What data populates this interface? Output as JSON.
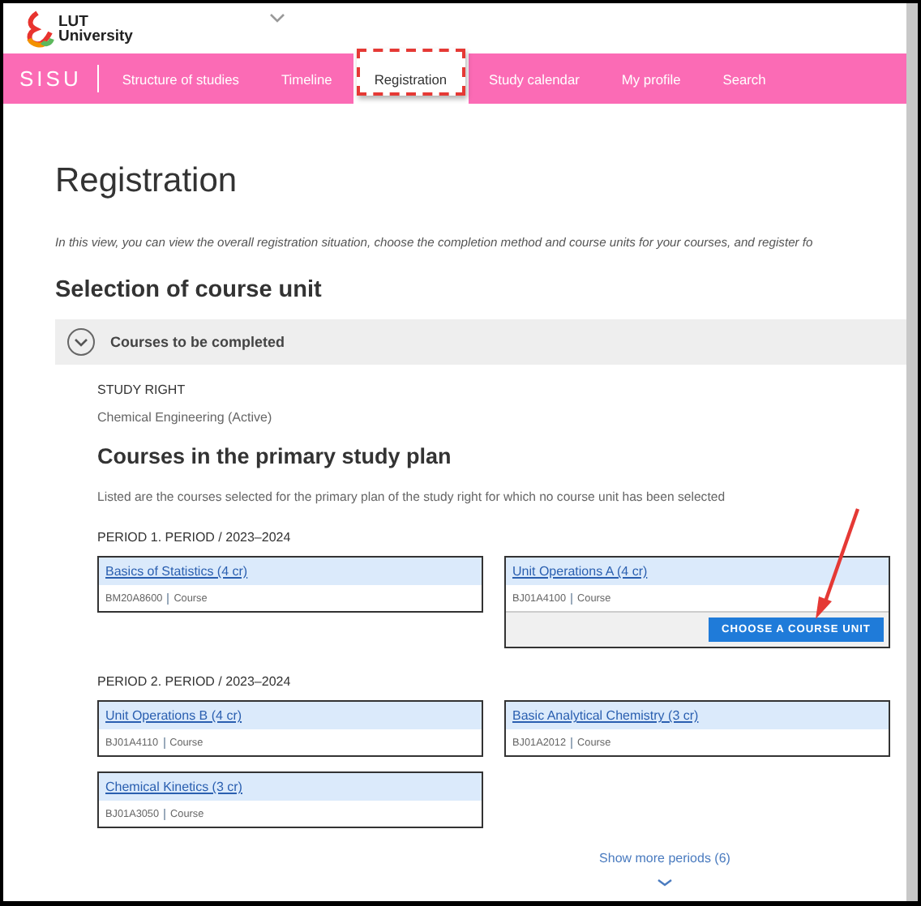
{
  "header": {
    "logo": "LUT\nUniversity"
  },
  "nav": {
    "brand": "SISU",
    "items": [
      {
        "label": "Structure of studies",
        "selected": false
      },
      {
        "label": "Timeline",
        "selected": false
      },
      {
        "label": "Registration",
        "selected": true
      },
      {
        "label": "Study calendar",
        "selected": false
      },
      {
        "label": "My profile",
        "selected": false
      },
      {
        "label": "Search",
        "selected": false
      }
    ]
  },
  "page": {
    "title": "Registration",
    "description": "In this view, you can view the overall registration situation, choose the completion method and course units for your courses, and register fo",
    "section_title": "Selection of course unit"
  },
  "panel": {
    "title": "Courses to be completed",
    "expanded": true,
    "study_right_label": "STUDY RIGHT",
    "study_right": "Chemical Engineering (Active)",
    "plan_title": "Courses in the primary study plan",
    "plan_note": "Listed are the courses selected for the primary plan of the study right for which no course unit has been selected",
    "periods": [
      {
        "title": "PERIOD 1. PERIOD / 2023–2024",
        "courses": [
          {
            "name": "Basics of Statistics (4 cr)",
            "code": "BM20A8600",
            "type": "Course"
          },
          {
            "name": "Unit Operations A (4 cr)",
            "code": "BJ01A4100",
            "type": "Course",
            "action": "CHOOSE A COURSE UNIT"
          }
        ]
      },
      {
        "title": "PERIOD 2. PERIOD / 2023–2024",
        "courses": [
          {
            "name": "Unit Operations B (4 cr)",
            "code": "BJ01A4110",
            "type": "Course"
          },
          {
            "name": "Basic Analytical Chemistry (3 cr)",
            "code": "BJ01A2012",
            "type": "Course"
          },
          {
            "name": "Chemical Kinetics (3 cr)",
            "code": "BJ01A3050",
            "type": "Course"
          }
        ]
      }
    ],
    "show_more": "Show more periods (6)"
  }
}
